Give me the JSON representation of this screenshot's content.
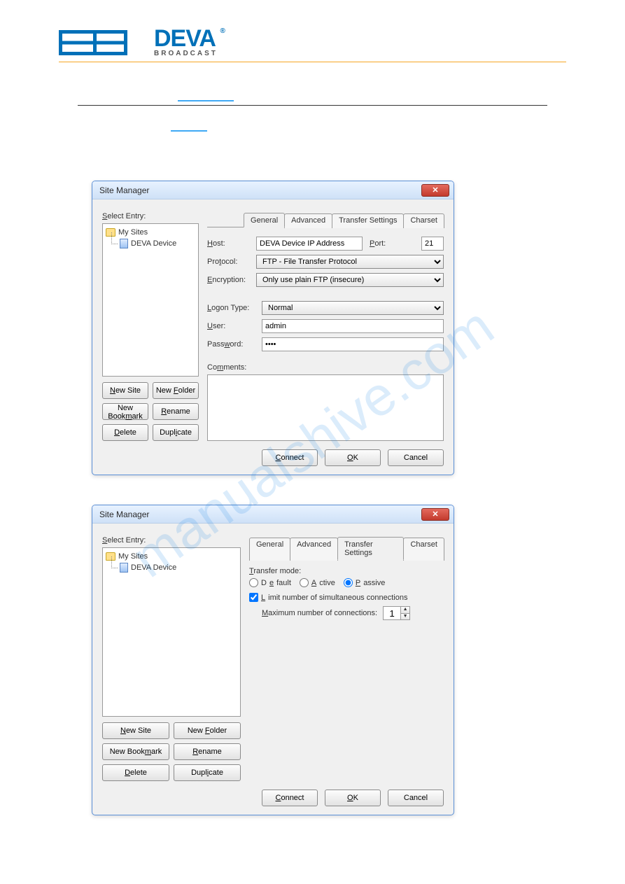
{
  "brand": {
    "name": "DEVA",
    "sub": "BROADCAST"
  },
  "watermark": "manualshive.com",
  "dialog": {
    "title": "Site Manager",
    "selectEntryLabel": "Select Entry:",
    "tree": {
      "root": "My Sites",
      "item": "DEVA Device"
    },
    "buttons": {
      "newSite": "New Site",
      "newFolder": "New Folder",
      "newBookmark": "New Bookmark",
      "rename": "Rename",
      "delete": "Delete",
      "duplicate": "Duplicate"
    },
    "tabs": {
      "general": "General",
      "advanced": "Advanced",
      "transfer": "Transfer Settings",
      "charset": "Charset"
    },
    "general": {
      "hostLbl": "Host:",
      "host": "DEVA Device IP Address",
      "portLbl": "Port:",
      "port": "21",
      "protocolLbl": "Protocol:",
      "protocol": "FTP - File Transfer Protocol",
      "encryptionLbl": "Encryption:",
      "encryption": "Only use plain FTP (insecure)",
      "logonTypeLbl": "Logon Type:",
      "logonType": "Normal",
      "userLbl": "User:",
      "user": "admin",
      "passwordLbl": "Password:",
      "password": "••••",
      "commentsLbl": "Comments:"
    },
    "transfer": {
      "transferModeLbl": "Transfer mode:",
      "default": "Default",
      "active": "Active",
      "passive": "Passive",
      "limitLbl": "Limit number of simultaneous connections",
      "maxLbl": "Maximum number of connections:",
      "max": "1"
    },
    "footer": {
      "connect": "Connect",
      "ok": "OK",
      "cancel": "Cancel"
    }
  }
}
